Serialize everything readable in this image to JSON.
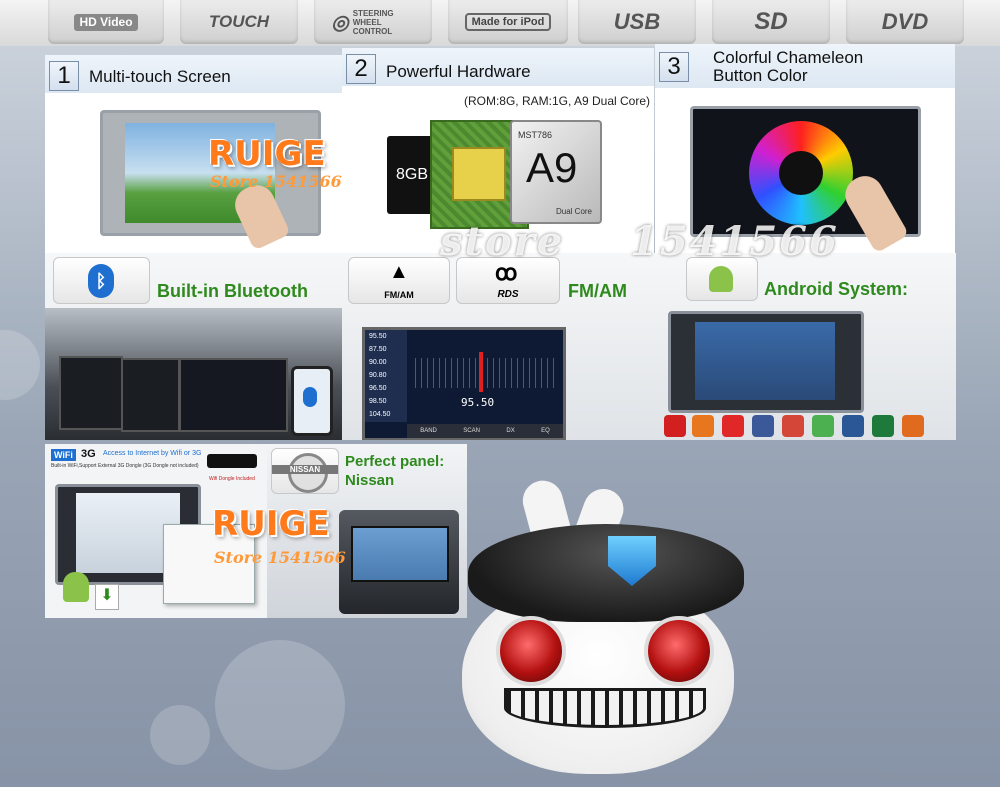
{
  "top_features": [
    "HD Video",
    "TOUCH",
    "STEERING WHEEL CONTROL",
    "Made for iPod",
    "USB",
    "SD",
    "DVD"
  ],
  "panels": {
    "p1": {
      "number": "1",
      "title": "Multi-touch Screen"
    },
    "p2": {
      "number": "2",
      "title": "Powerful Hardware",
      "spec": "(ROM:8G, RAM:1G, A9 Dual Core)",
      "chip_label": "8GB",
      "cpu_model": "MST786",
      "cpu_name": "A9",
      "cpu_sub": "Dual Core"
    },
    "p3": {
      "number": "3",
      "title_line1": "Colorful Chameleon",
      "title_line2": "Button Color"
    }
  },
  "bluetooth": {
    "title": "Built-in Bluetooth"
  },
  "radio": {
    "title": "FM/AM",
    "fm_icon_label": "FM/AM",
    "rds_label": "RDS",
    "freq_list": [
      "95.50",
      "87.50",
      "90.00",
      "90.80",
      "96.50",
      "98.50",
      "104.50"
    ],
    "freq_display": "95.50",
    "buttons": [
      "BAND",
      "SCAN",
      "DX",
      "EQ"
    ]
  },
  "android": {
    "title": "Android System:"
  },
  "wifi": {
    "label_wifi": "WiFi",
    "label_3g": "3G",
    "headline": "Access to Internet by Wifi or 3G",
    "sub": "Built-in WiFi,Support External 3G Dongle (3G Dongle not included)",
    "dongle_note": "Wifi Dongle Included"
  },
  "nissan": {
    "logo": "NISSAN",
    "line1": "Perfect panel:",
    "line2": "Nissan"
  },
  "watermarks": {
    "brand": "RUIGE",
    "store_small": "Store 1541566",
    "store_big_1": "store",
    "store_big_2": "1541566"
  },
  "colors": {
    "accent_green": "#2f8a1e",
    "brand_orange": "#ff7a1a",
    "bluetooth_blue": "#1e6fd0"
  }
}
